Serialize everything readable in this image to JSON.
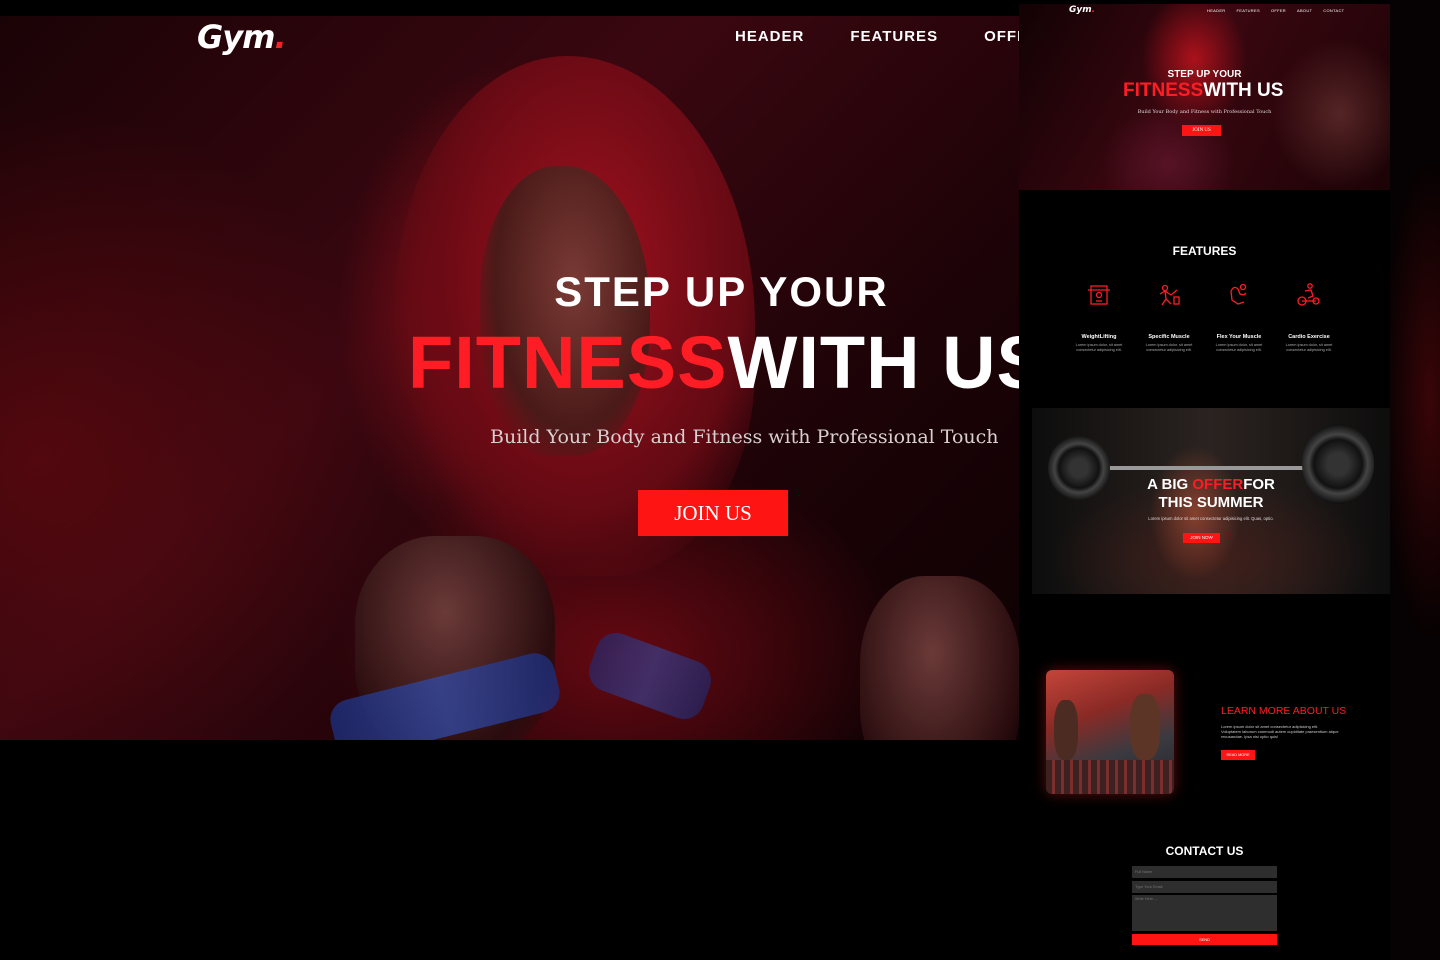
{
  "hero": {
    "logo_text": "Gym",
    "logo_dot": ".",
    "nav": [
      "HEADER",
      "FEATURES",
      "OFFER"
    ],
    "line1": "STEP UP YOUR",
    "line2_red": "FITNESS",
    "line2_white": "WITH US",
    "subtitle": "Build Your Body and Fitness with Professional Touch",
    "cta": "JOIN US"
  },
  "preview": {
    "logo_text": "Gym",
    "logo_dot": ".",
    "nav": [
      "HEADER",
      "FEATURES",
      "OFFER",
      "ABOUT",
      "CONTACT"
    ],
    "hero_line1": "STEP UP YOUR",
    "hero_line2_red": "FITNESS",
    "hero_line2_white": "WITH US",
    "hero_subtitle": "Build Your Body and Fitness with Professional Touch",
    "hero_cta": "JOIN US",
    "features_title": "FEATURES",
    "features": [
      {
        "name": "WeightLifting",
        "desc": "Lorem ipsum dolor, sit amet consectetur adipisicing elit.",
        "icon": "weightlifting-icon"
      },
      {
        "name": "Specific Muscle",
        "desc": "Lorem ipsum dolor, sit amet consectetur adipisicing elit.",
        "icon": "muscle-training-icon"
      },
      {
        "name": "Flex Your Muscle",
        "desc": "Lorem ipsum dolor, sit amet consectetur adipisicing elit.",
        "icon": "flex-arm-icon"
      },
      {
        "name": "Cardio Exercise",
        "desc": "Lorem ipsum dolor, sit amet consectetur adipisicing elit.",
        "icon": "exercise-bike-icon"
      }
    ],
    "offer_line1_pre": "A BIG ",
    "offer_line1_red": "OFFER",
    "offer_line1_post": "FOR",
    "offer_line2": "THIS SUMMER",
    "offer_text": "Lorem ipsum dolor sit amet consectetur adipisicing elit. Quas, optio.",
    "offer_cta": "JOIN NOW",
    "about_title": "LEARN MORE ABOUT US",
    "about_text": "Lorem ipsum dolor sit amet consectetur adipisicing elit. Voluptatem laborum commodi autem cupiditate praesentium atque recusandae. Ipsa nisi optio quis!",
    "about_cta": "READ MORE",
    "contact_title": "CONTACT US",
    "contact_name_placeholder": "Full Name",
    "contact_email_placeholder": "Type Your Email",
    "contact_msg_placeholder": "Write Here.....",
    "contact_send": "SEND"
  },
  "colors": {
    "accent": "#ff1d25",
    "button": "#ff1414",
    "background": "#000000"
  }
}
